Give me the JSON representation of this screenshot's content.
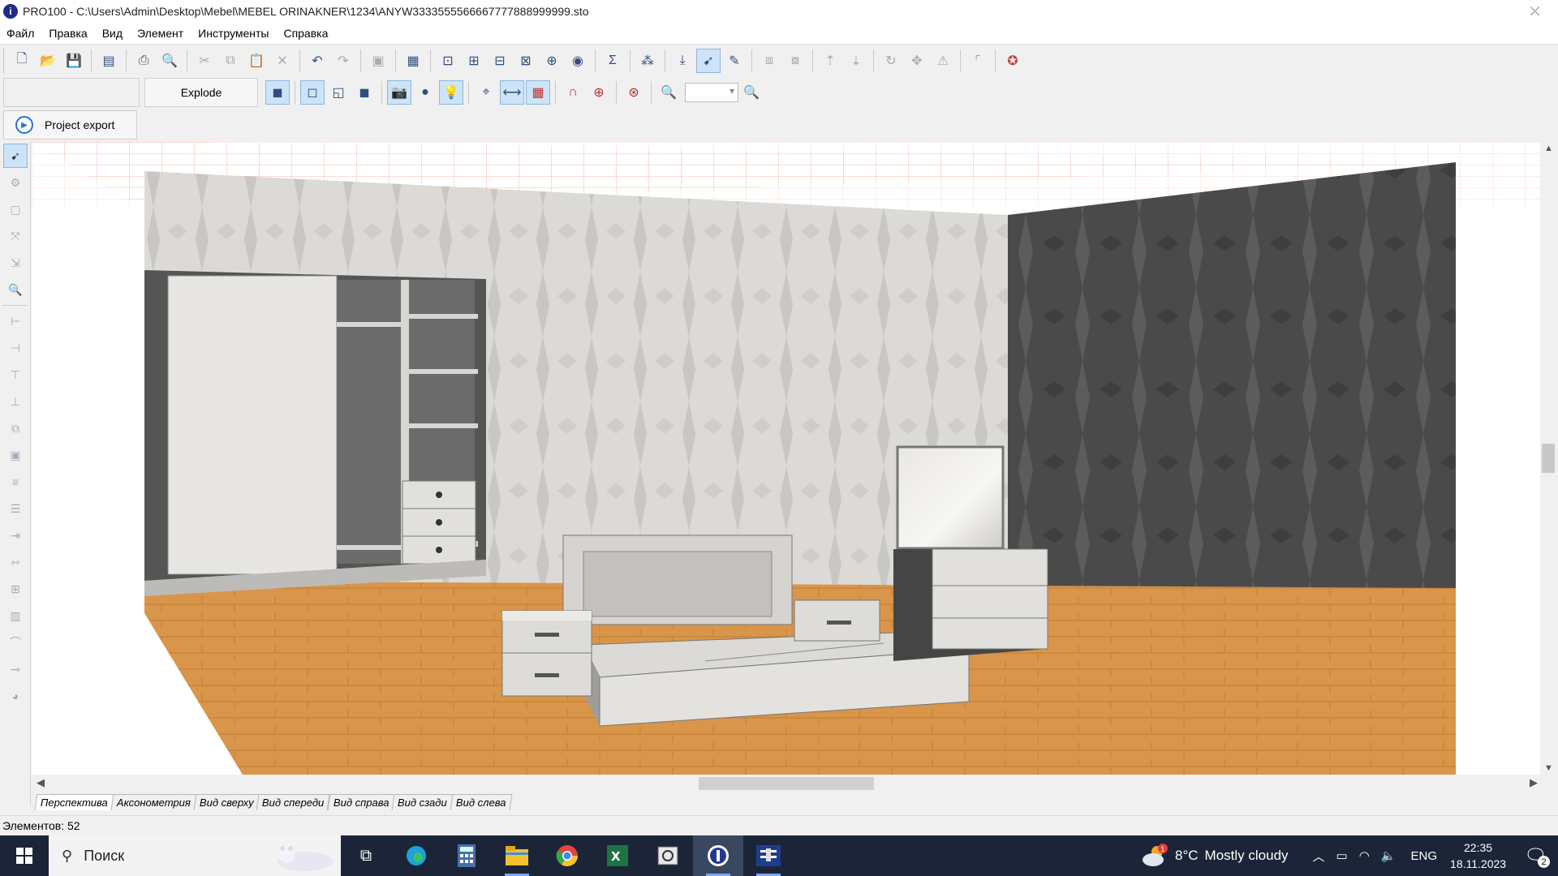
{
  "window": {
    "title": "PRO100 - C:\\Users\\Admin\\Desktop\\Mebel\\MEBEL ORINAKNER\\1234\\ANYW3333555566667777888999999.sto",
    "app_icon": "pro100-logo-icon"
  },
  "menu": [
    "Файл",
    "Правка",
    "Вид",
    "Элемент",
    "Инструменты",
    "Справка"
  ],
  "toolbar": {
    "explode_label": "Explode",
    "project_export_label": "Project export",
    "zoom_value": ""
  },
  "view_tabs": [
    "Перспектива",
    "Аксонометрия",
    "Вид сверху",
    "Вид спереди",
    "Вид справа",
    "Вид сзади",
    "Вид слева"
  ],
  "active_view_tab": "Перспектива",
  "status": {
    "elements_count": "Элементов: 52"
  },
  "taskbar": {
    "search_placeholder": "Поиск",
    "weather_temp": "8°C",
    "weather_desc": "Mostly cloudy",
    "weather_badge": "1",
    "language": "ENG",
    "time": "22:35",
    "date": "18.11.2023",
    "notification_count": "2"
  },
  "colors": {
    "taskbar_bg": "#1c2537",
    "selected_tool_bg": "#cde3f7",
    "floor": "#d9954a",
    "wall_light": "#dddbd8",
    "wall_dark": "#4e4e4e"
  }
}
